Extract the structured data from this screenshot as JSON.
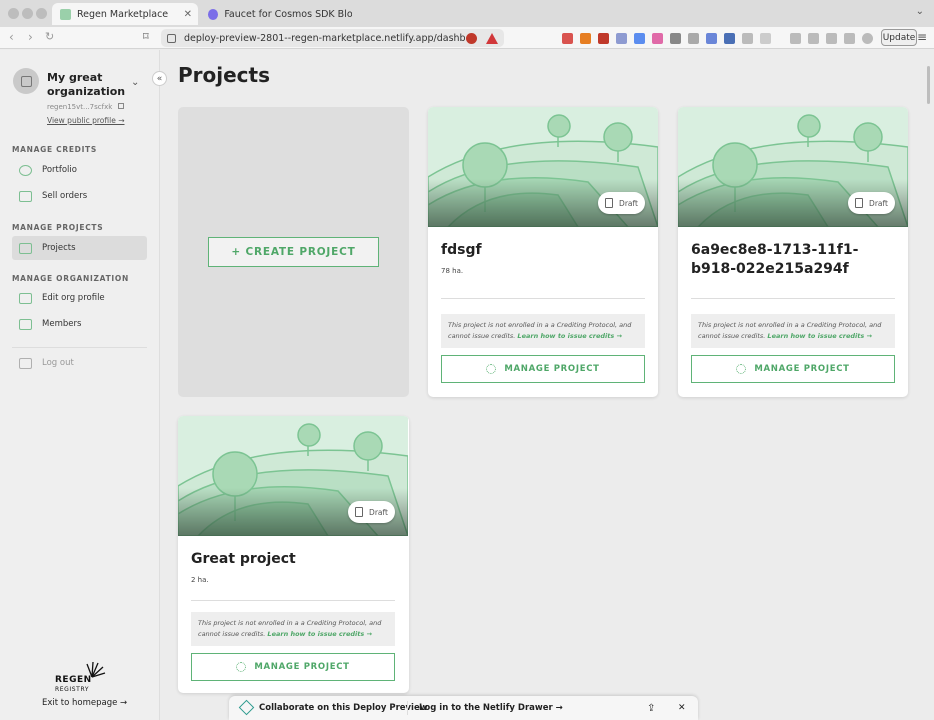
{
  "browser": {
    "tabs": [
      {
        "label": "Regen Marketplace",
        "active": true
      },
      {
        "label": "Faucet for Cosmos SDK Blockcha",
        "active": false
      }
    ],
    "url": "deploy-preview-2801--regen-marketplace.netlify.app/dashb...",
    "update_label": "Update"
  },
  "sidebar": {
    "org_name": "My great organization",
    "org_address": "regen15vt...7scfxk",
    "view_profile": "View public profile →",
    "sections": {
      "credits": "MANAGE CREDITS",
      "projects": "MANAGE PROJECTS",
      "organization": "MANAGE ORGANIZATION"
    },
    "items": {
      "portfolio": "Portfolio",
      "sell_orders": "Sell orders",
      "projects": "Projects",
      "edit_org": "Edit org profile",
      "members": "Members",
      "logout": "Log out"
    },
    "brand": {
      "name": "REGEN",
      "sub": "REGISTRY"
    },
    "exit": "Exit to homepage →"
  },
  "main": {
    "title": "Projects",
    "create_label": "+ CREATE PROJECT",
    "draft_label": "Draft",
    "notice_text": "This project is not enrolled in a a Crediting Protocol, and cannot issue credits.",
    "notice_link": "Learn how to issue credits →",
    "manage_label": "MANAGE PROJECT",
    "projects": [
      {
        "title": "fdsgf",
        "area": "78 ha."
      },
      {
        "title": "6a9ec8e8-1713-11f1-b918-022e215a294f",
        "area": ""
      },
      {
        "title": "Great project",
        "area": "2 ha."
      }
    ]
  },
  "netlify": {
    "collaborate": "Collaborate on this Deploy Preview",
    "login": "Log in to the Netlify Drawer →"
  },
  "colors": {
    "accent": "#4fa768",
    "hill_light": "#cfe9d6",
    "hill_dark": "#7cc493"
  }
}
